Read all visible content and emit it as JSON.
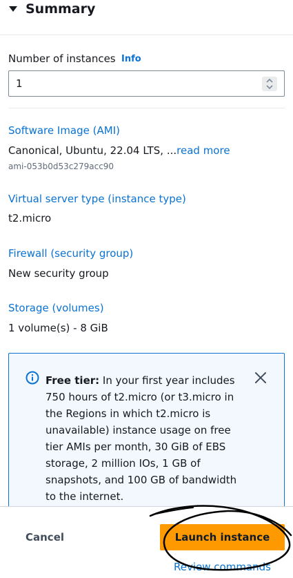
{
  "summary": {
    "title": "Summary"
  },
  "instances": {
    "label": "Number of instances",
    "info_link": "Info",
    "value": "1"
  },
  "sections": {
    "ami": {
      "label": "Software Image (AMI)",
      "value": "Canonical, Ubuntu, 22.04 LTS, ...",
      "read_more": "read more",
      "ami_id": "ami-053b0d53c279acc90"
    },
    "instance_type": {
      "label": "Virtual server type (instance type)",
      "value": "t2.micro"
    },
    "firewall": {
      "label": "Firewall (security group)",
      "value": "New security group"
    },
    "storage": {
      "label": "Storage (volumes)",
      "value": "1 volume(s) - 8 GiB"
    }
  },
  "free_tier": {
    "heading": "Free tier:",
    "body": " In your first year includes 750 hours of t2.micro (or t3.micro in the Regions in which t2.micro is unavailable) instance usage on free tier AMIs per month, 30 GiB of EBS storage, 2 million IOs, 1 GB of snapshots, and 100 GB of bandwidth to the internet."
  },
  "footer": {
    "cancel_label": "Cancel",
    "launch_label": "Launch instance",
    "review_label": "Review commands"
  },
  "colors": {
    "link": "#0972d3",
    "primary_button": "#ff9900",
    "alert_background": "#f2f8fd",
    "alert_border": "#0972d3"
  },
  "icons": {
    "caret": "caret-down-icon",
    "stepper": "stepper-icon",
    "info": "info-circle-icon",
    "close": "close-icon"
  }
}
